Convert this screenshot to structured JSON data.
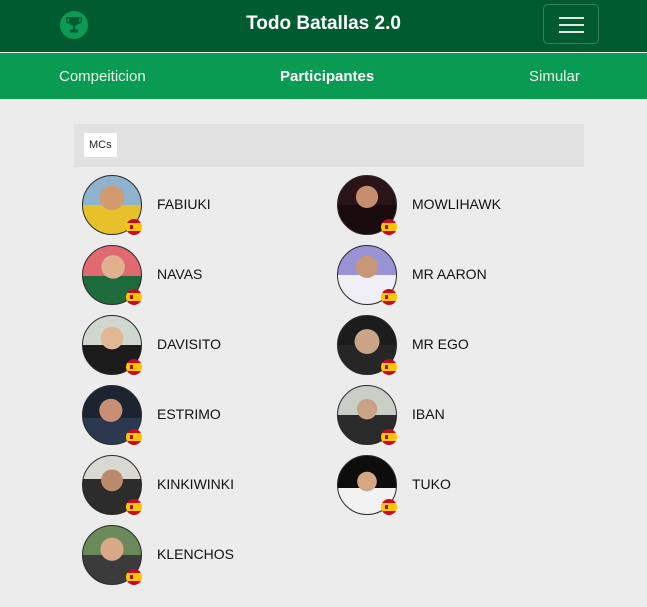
{
  "header": {
    "title": "Todo Batallas 2.0",
    "logo_icon": "trophy-icon",
    "menu_icon": "hamburger-menu-icon"
  },
  "nav": {
    "tabs": [
      {
        "label": "Compeiticion",
        "active": false
      },
      {
        "label": "Participantes",
        "active": true
      },
      {
        "label": "Simular",
        "active": false
      }
    ]
  },
  "section": {
    "label": "MCs"
  },
  "mcs": [
    {
      "name": "FABIUKI",
      "country_flag": "spain-flag-icon"
    },
    {
      "name": "MOWLIHAWK",
      "country_flag": "spain-flag-icon"
    },
    {
      "name": "NAVAS",
      "country_flag": "spain-flag-icon"
    },
    {
      "name": "MR AARON",
      "country_flag": "spain-flag-icon"
    },
    {
      "name": "DAVISITO",
      "country_flag": "spain-flag-icon"
    },
    {
      "name": "MR EGO",
      "country_flag": "spain-flag-icon"
    },
    {
      "name": "ESTRIMO",
      "country_flag": "spain-flag-icon"
    },
    {
      "name": "IBAN",
      "country_flag": "spain-flag-icon"
    },
    {
      "name": "KINKIWINKI",
      "country_flag": "spain-flag-icon"
    },
    {
      "name": "TUKO",
      "country_flag": "spain-flag-icon"
    },
    {
      "name": "KLENCHOS",
      "country_flag": "spain-flag-icon"
    }
  ],
  "colors": {
    "header_bg": "#005c30",
    "tabs_bg": "#0a9b52",
    "page_bg": "#ececec"
  }
}
